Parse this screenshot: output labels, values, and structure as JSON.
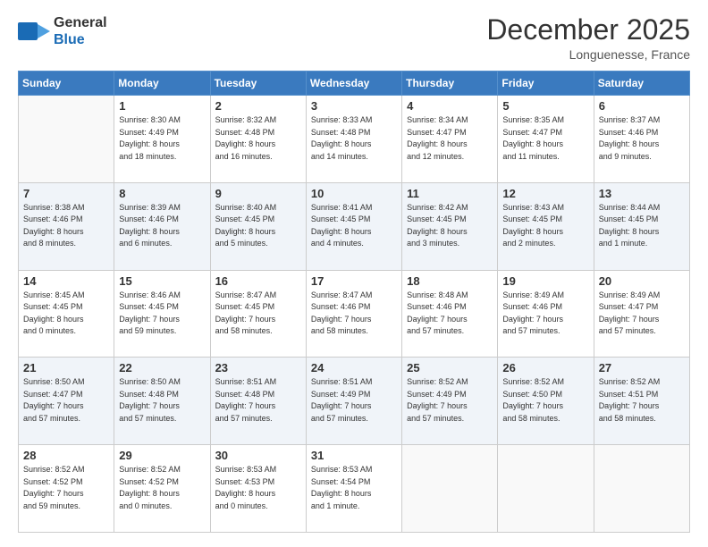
{
  "header": {
    "logo_line1": "General",
    "logo_line2": "Blue",
    "month": "December 2025",
    "location": "Longuenesse, France"
  },
  "weekdays": [
    "Sunday",
    "Monday",
    "Tuesday",
    "Wednesday",
    "Thursday",
    "Friday",
    "Saturday"
  ],
  "weeks": [
    [
      {
        "day": "",
        "info": ""
      },
      {
        "day": "1",
        "info": "Sunrise: 8:30 AM\nSunset: 4:49 PM\nDaylight: 8 hours\nand 18 minutes."
      },
      {
        "day": "2",
        "info": "Sunrise: 8:32 AM\nSunset: 4:48 PM\nDaylight: 8 hours\nand 16 minutes."
      },
      {
        "day": "3",
        "info": "Sunrise: 8:33 AM\nSunset: 4:48 PM\nDaylight: 8 hours\nand 14 minutes."
      },
      {
        "day": "4",
        "info": "Sunrise: 8:34 AM\nSunset: 4:47 PM\nDaylight: 8 hours\nand 12 minutes."
      },
      {
        "day": "5",
        "info": "Sunrise: 8:35 AM\nSunset: 4:47 PM\nDaylight: 8 hours\nand 11 minutes."
      },
      {
        "day": "6",
        "info": "Sunrise: 8:37 AM\nSunset: 4:46 PM\nDaylight: 8 hours\nand 9 minutes."
      }
    ],
    [
      {
        "day": "7",
        "info": "Sunrise: 8:38 AM\nSunset: 4:46 PM\nDaylight: 8 hours\nand 8 minutes."
      },
      {
        "day": "8",
        "info": "Sunrise: 8:39 AM\nSunset: 4:46 PM\nDaylight: 8 hours\nand 6 minutes."
      },
      {
        "day": "9",
        "info": "Sunrise: 8:40 AM\nSunset: 4:45 PM\nDaylight: 8 hours\nand 5 minutes."
      },
      {
        "day": "10",
        "info": "Sunrise: 8:41 AM\nSunset: 4:45 PM\nDaylight: 8 hours\nand 4 minutes."
      },
      {
        "day": "11",
        "info": "Sunrise: 8:42 AM\nSunset: 4:45 PM\nDaylight: 8 hours\nand 3 minutes."
      },
      {
        "day": "12",
        "info": "Sunrise: 8:43 AM\nSunset: 4:45 PM\nDaylight: 8 hours\nand 2 minutes."
      },
      {
        "day": "13",
        "info": "Sunrise: 8:44 AM\nSunset: 4:45 PM\nDaylight: 8 hours\nand 1 minute."
      }
    ],
    [
      {
        "day": "14",
        "info": "Sunrise: 8:45 AM\nSunset: 4:45 PM\nDaylight: 8 hours\nand 0 minutes."
      },
      {
        "day": "15",
        "info": "Sunrise: 8:46 AM\nSunset: 4:45 PM\nDaylight: 7 hours\nand 59 minutes."
      },
      {
        "day": "16",
        "info": "Sunrise: 8:47 AM\nSunset: 4:45 PM\nDaylight: 7 hours\nand 58 minutes."
      },
      {
        "day": "17",
        "info": "Sunrise: 8:47 AM\nSunset: 4:46 PM\nDaylight: 7 hours\nand 58 minutes."
      },
      {
        "day": "18",
        "info": "Sunrise: 8:48 AM\nSunset: 4:46 PM\nDaylight: 7 hours\nand 57 minutes."
      },
      {
        "day": "19",
        "info": "Sunrise: 8:49 AM\nSunset: 4:46 PM\nDaylight: 7 hours\nand 57 minutes."
      },
      {
        "day": "20",
        "info": "Sunrise: 8:49 AM\nSunset: 4:47 PM\nDaylight: 7 hours\nand 57 minutes."
      }
    ],
    [
      {
        "day": "21",
        "info": "Sunrise: 8:50 AM\nSunset: 4:47 PM\nDaylight: 7 hours\nand 57 minutes."
      },
      {
        "day": "22",
        "info": "Sunrise: 8:50 AM\nSunset: 4:48 PM\nDaylight: 7 hours\nand 57 minutes."
      },
      {
        "day": "23",
        "info": "Sunrise: 8:51 AM\nSunset: 4:48 PM\nDaylight: 7 hours\nand 57 minutes."
      },
      {
        "day": "24",
        "info": "Sunrise: 8:51 AM\nSunset: 4:49 PM\nDaylight: 7 hours\nand 57 minutes."
      },
      {
        "day": "25",
        "info": "Sunrise: 8:52 AM\nSunset: 4:49 PM\nDaylight: 7 hours\nand 57 minutes."
      },
      {
        "day": "26",
        "info": "Sunrise: 8:52 AM\nSunset: 4:50 PM\nDaylight: 7 hours\nand 58 minutes."
      },
      {
        "day": "27",
        "info": "Sunrise: 8:52 AM\nSunset: 4:51 PM\nDaylight: 7 hours\nand 58 minutes."
      }
    ],
    [
      {
        "day": "28",
        "info": "Sunrise: 8:52 AM\nSunset: 4:52 PM\nDaylight: 7 hours\nand 59 minutes."
      },
      {
        "day": "29",
        "info": "Sunrise: 8:52 AM\nSunset: 4:52 PM\nDaylight: 8 hours\nand 0 minutes."
      },
      {
        "day": "30",
        "info": "Sunrise: 8:53 AM\nSunset: 4:53 PM\nDaylight: 8 hours\nand 0 minutes."
      },
      {
        "day": "31",
        "info": "Sunrise: 8:53 AM\nSunset: 4:54 PM\nDaylight: 8 hours\nand 1 minute."
      },
      {
        "day": "",
        "info": ""
      },
      {
        "day": "",
        "info": ""
      },
      {
        "day": "",
        "info": ""
      }
    ]
  ]
}
